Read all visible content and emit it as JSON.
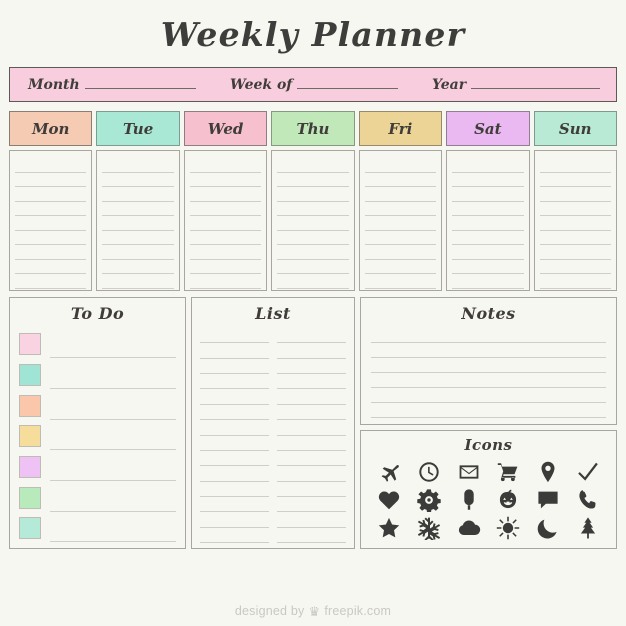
{
  "title": "Weekly Planner",
  "header": {
    "fields": [
      {
        "label": "Month"
      },
      {
        "label": "Week of"
      },
      {
        "label": "Year"
      }
    ]
  },
  "days": [
    {
      "label": "Mon",
      "color": "#f5cbb4",
      "border": "#8a7d72",
      "lines": 9
    },
    {
      "label": "Tue",
      "color": "#a9e8d5",
      "border": "#7d9d92",
      "lines": 9
    },
    {
      "label": "Wed",
      "color": "#f7c0cf",
      "border": "#8f7d83",
      "lines": 9
    },
    {
      "label": "Thu",
      "color": "#c0e8b8",
      "border": "#879a81",
      "lines": 9
    },
    {
      "label": "Fri",
      "color": "#ecd496",
      "border": "#968a6b",
      "lines": 9
    },
    {
      "label": "Sat",
      "color": "#eab9f2",
      "border": "#8e7f93",
      "lines": 9
    },
    {
      "label": "Sun",
      "color": "#b9ead6",
      "border": "#7f9a8d",
      "lines": 9
    }
  ],
  "todo": {
    "title": "To Do",
    "items": [
      {
        "color": "#f9d3e2"
      },
      {
        "color": "#9fe4d4"
      },
      {
        "color": "#fbc7ab"
      },
      {
        "color": "#f7dd9c"
      },
      {
        "color": "#eec2f5"
      },
      {
        "color": "#b8eabb"
      },
      {
        "color": "#b5ead8"
      }
    ]
  },
  "list": {
    "title": "List",
    "rows": 14,
    "columns": 2
  },
  "notes": {
    "title": "Notes",
    "lines": 6
  },
  "icons": {
    "title": "Icons",
    "items": [
      {
        "name": "plane-icon"
      },
      {
        "name": "clock-icon"
      },
      {
        "name": "envelope-icon"
      },
      {
        "name": "shopping-cart-icon"
      },
      {
        "name": "location-pin-icon"
      },
      {
        "name": "check-icon"
      },
      {
        "name": "heart-icon"
      },
      {
        "name": "gear-icon"
      },
      {
        "name": "popsicle-icon"
      },
      {
        "name": "pumpkin-icon"
      },
      {
        "name": "speech-bubble-icon"
      },
      {
        "name": "phone-icon"
      },
      {
        "name": "star-icon"
      },
      {
        "name": "snowflake-icon"
      },
      {
        "name": "cloud-icon"
      },
      {
        "name": "sun-icon"
      },
      {
        "name": "moon-icon"
      },
      {
        "name": "pine-tree-icon"
      }
    ]
  },
  "footer": {
    "prefix": "designed by",
    "crown": "♛",
    "brand": "freepik.com"
  },
  "colors": {
    "background": "#f7f7f1",
    "ink": "#3f3c39",
    "rule": "#cfcec7",
    "panel_border": "#a9a6a0",
    "header_pink": "#f8cede",
    "header_border": "#5d5954"
  }
}
